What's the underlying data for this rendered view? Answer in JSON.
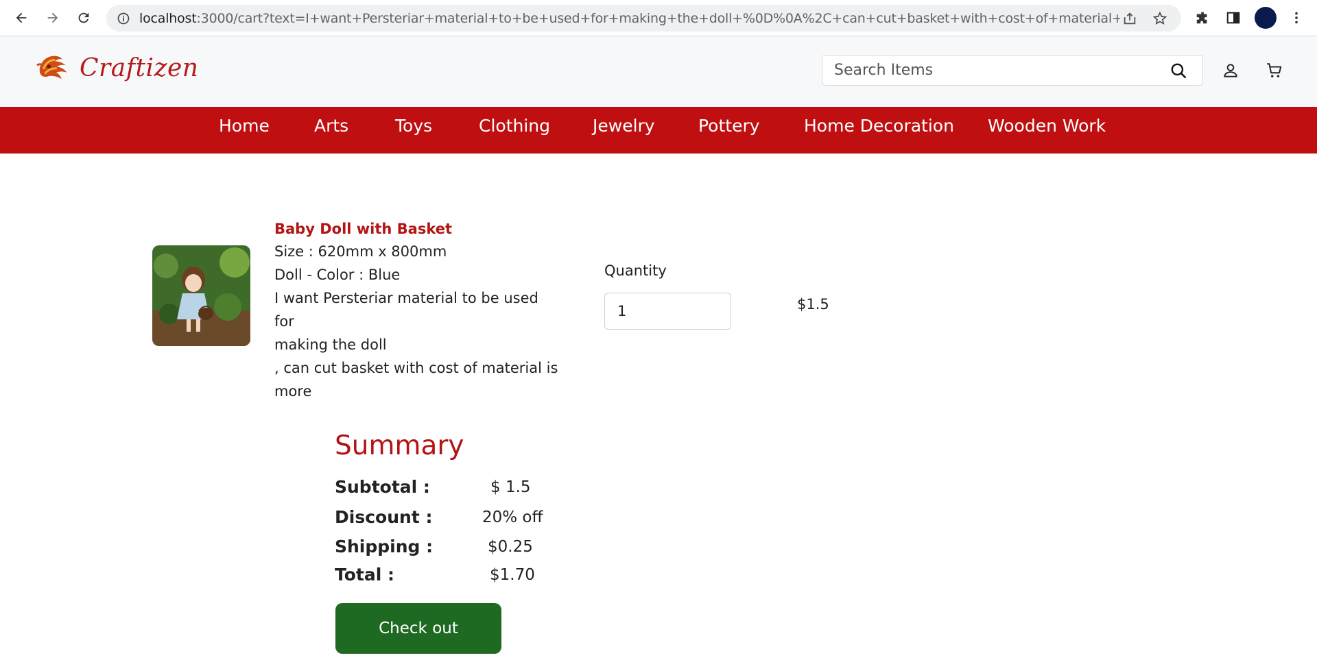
{
  "browser": {
    "url_host": "localhost",
    "url_rest": ":3000/cart?text=I+want+Persteriar+material+to+be+used+for+making+the+doll+%0D%0A%2C+can+cut+basket+with+cost+of+material+is+more+"
  },
  "site": {
    "logo_text": "Craftizen",
    "search_placeholder": "Search Items",
    "brand_color": "#bf0f11"
  },
  "nav": {
    "items": [
      "Home",
      "Arts",
      "Toys",
      "Clothing",
      "Jewelry",
      "Pottery",
      "Home Decoration",
      "Wooden Work"
    ]
  },
  "cart": {
    "item": {
      "title": "Baby Doll with Basket",
      "size": "Size : 620mm x 800mm",
      "color": "Doll - Color :  Blue",
      "note_line1": "I want Persteriar material to be used for",
      "note_line2": "making the doll",
      "note_line3": ", can cut basket with cost of material is",
      "note_line4": "more",
      "quantity_label": "Quantity",
      "quantity": "1",
      "price": "$1.5"
    }
  },
  "summary": {
    "title": "Summary",
    "subtotal_label": "Subtotal :",
    "subtotal_value": "$ 1.5",
    "discount_label": "Discount :",
    "discount_value": "20% off",
    "shipping_label": "Shipping :",
    "shipping_value": "$0.25",
    "total_label": "Total :",
    "total_value": "$1.70",
    "checkout_label": "Check out",
    "checkout_color": "#1f6a22"
  }
}
